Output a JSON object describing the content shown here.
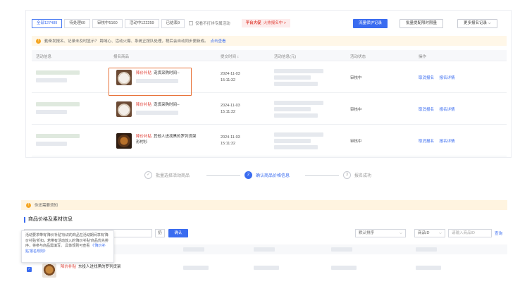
{
  "filter_tabs": [
    {
      "label": "全部127489",
      "active": true
    },
    {
      "label": "待处理60",
      "active": false
    },
    {
      "label": "审核中5160",
      "active": false
    },
    {
      "label": "活动中122259",
      "active": false
    },
    {
      "label": "已结束9",
      "active": false
    }
  ],
  "only_hide_option": "仅看不打烊专属活动",
  "promo": {
    "strong": "平台大促",
    "text": "火热报名中 >"
  },
  "toolbar": {
    "protect_records": "流量保护记录",
    "batch_settings": "批量提配限时限量",
    "more_records": "更多报名记录"
  },
  "notice": {
    "text": "勤奋发报名、记录未及时显示？ 跨域心、活动火爆、系统正按队处理，稍后会自动同步更新成。",
    "link": "点击查看"
  },
  "table": {
    "headers": [
      "活动信息",
      "报名商品",
      "提交时间",
      "活动信息(元)",
      "活动状态",
      "操作"
    ],
    "sort_hint": "↕",
    "rows": [
      {
        "tag": "降价补贴",
        "product": "宠货采购时间--",
        "date": "2024-11-03",
        "time": "15:11:32",
        "status": "审核中",
        "ops": [
          "取消报名",
          "报名详情"
        ]
      },
      {
        "tag": "降价补贴",
        "product": "宠货采购时间--",
        "date": "2024-11-03",
        "time": "15:11:32",
        "status": "审核中",
        "ops": [
          "取消报名",
          "报名详情"
        ]
      },
      {
        "tag": "降价补贴",
        "product": "其他人进找黑的罗列货架形村衫",
        "date": "2024-11-03",
        "time": "15:11:32",
        "status": "审核中",
        "ops": [
          "取消报名",
          "报名详情"
        ]
      }
    ]
  },
  "steps": [
    {
      "num": "✓",
      "label": "批量选择活动商品",
      "state": "done"
    },
    {
      "num": "2",
      "label": "确认商品价格信息",
      "state": "current"
    },
    {
      "num": "3",
      "label": "报名成功",
      "state": "todo"
    }
  ],
  "bottom": {
    "warning": "你还需要须知",
    "section_title": "商品价格及素材信息",
    "search_placeholder": "请输入商品ID/名称",
    "small_btn": "扔",
    "confirm_btn": "确认",
    "sort_select": "默认排序",
    "type_select": "商品ID",
    "id_placeholder": "请输入商品ID",
    "query": "查询",
    "tooltip": {
      "text": "活动要求带有'降价补贴'标识的商品在活动期间享有'降价补贴'折扣，若带有活动放入的'降价补贴'商品优先排序，将参与商品需填写。 具体规则可查看",
      "link": "《'降价补贴'报名规则》"
    },
    "row": {
      "tag": "降价补贴",
      "product": "东投人进找黑的罗列货架"
    }
  },
  "colors": {
    "primary": "#3a6cf0",
    "highlight": "#e8743b",
    "tag": "#e0433a"
  }
}
